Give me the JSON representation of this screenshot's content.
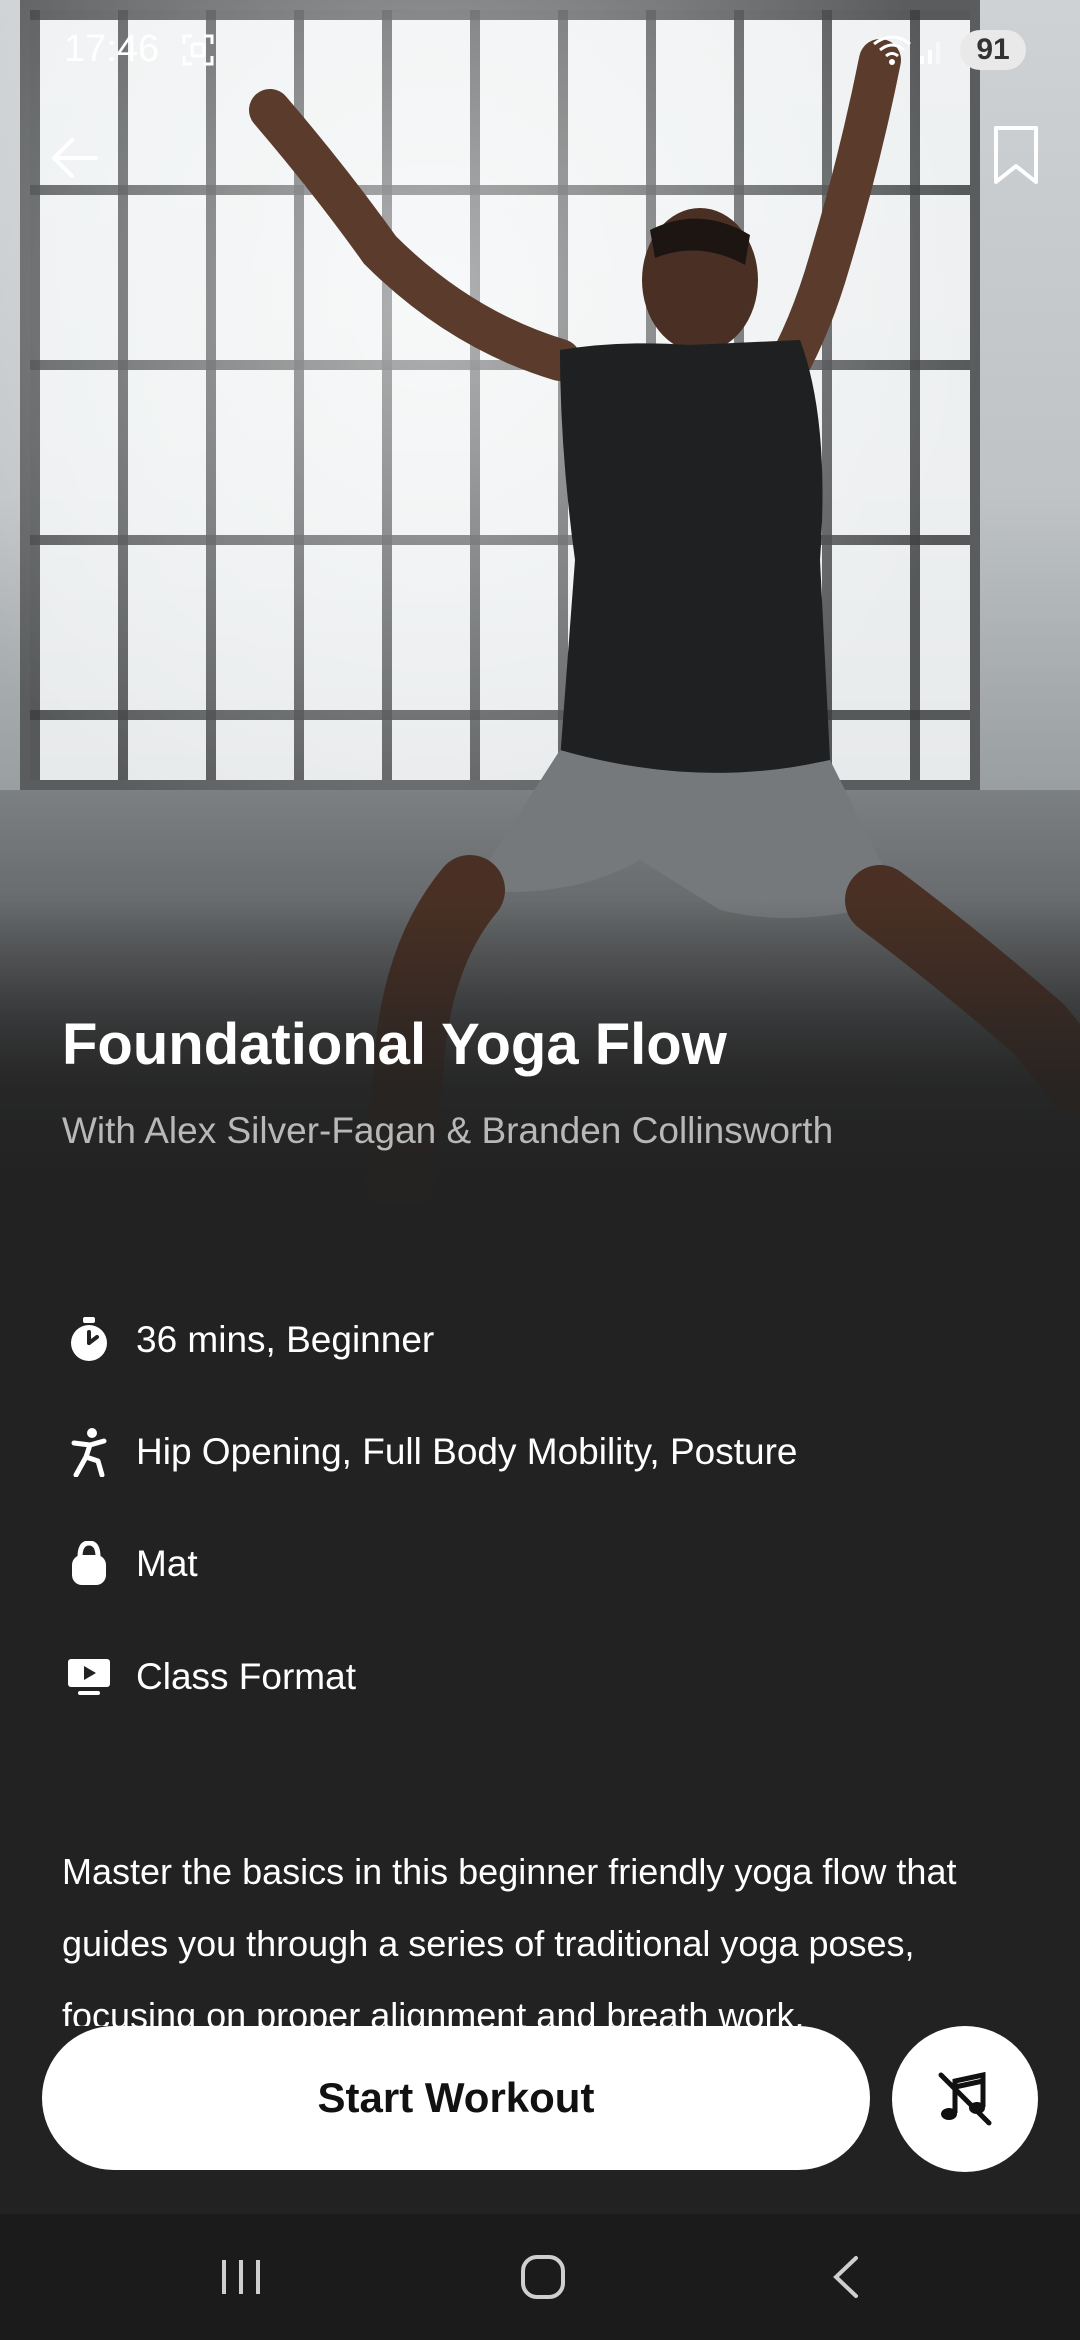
{
  "status_bar": {
    "time": "17:46",
    "battery": "91"
  },
  "workout": {
    "title": "Foundational Yoga Flow",
    "subtitle": "With Alex Silver-Fagan & Branden Collinsworth",
    "details": [
      {
        "icon": "stopwatch-icon",
        "text": "36 mins, Beginner"
      },
      {
        "icon": "figure-icon",
        "text": "Hip Opening, Full Body Mobility, Posture"
      },
      {
        "icon": "kettlebell-icon",
        "text": "Mat"
      },
      {
        "icon": "video-class-icon",
        "text": "Class Format"
      }
    ],
    "description": "Master the basics in this beginner friendly yoga flow that guides you through a series of traditional yoga poses, focusing on proper alignment and breath work."
  },
  "actions": {
    "start_label": "Start Workout"
  },
  "colors": {
    "background": "#222222",
    "button": "#ffffff",
    "subtitle": "#b8b8b8"
  }
}
